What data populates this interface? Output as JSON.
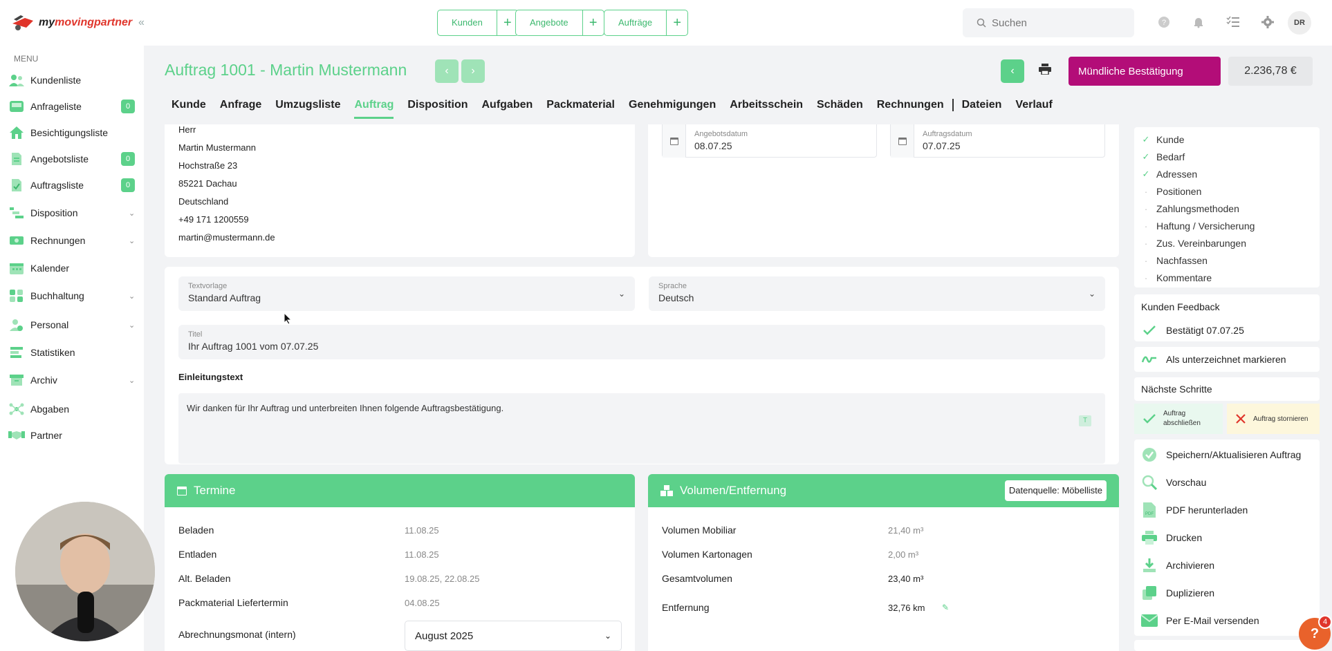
{
  "brand": {
    "name_prefix": "my",
    "name_rest": "movingpartner",
    "accent": "#e0352b",
    "green": "#5cd18a",
    "magenta": "#b30d78"
  },
  "topbar": {
    "quick_actions": [
      {
        "label": "Kunden",
        "plus": "+"
      },
      {
        "label": "Angebote",
        "plus": "+"
      },
      {
        "label": "Aufträge",
        "plus": "+"
      }
    ],
    "search": {
      "placeholder": "Suchen"
    },
    "icons": [
      "help-circle-icon",
      "bell-icon",
      "checklist-icon",
      "gear-icon"
    ],
    "avatar_initials": "DR"
  },
  "sidebar": {
    "caption": "MENU",
    "collapse_icon": "«",
    "items": [
      {
        "label": "Kundenliste",
        "icon": "users-icon"
      },
      {
        "label": "Anfrageliste",
        "icon": "inbox-icon",
        "badge": "0"
      },
      {
        "label": "Besichtigungsliste",
        "icon": "house-icon"
      },
      {
        "label": "Angebotsliste",
        "icon": "document-icon",
        "badge": "0"
      },
      {
        "label": "Auftragsliste",
        "icon": "order-document-icon",
        "badge": "0"
      },
      {
        "label": "Disposition",
        "icon": "dispatch-icon",
        "expandable": true
      },
      {
        "label": "Rechnungen",
        "icon": "invoice-icon",
        "expandable": true
      },
      {
        "label": "Kalender",
        "icon": "calendar-icon"
      },
      {
        "label": "Buchhaltung",
        "icon": "accounting-icon",
        "expandable": true
      },
      {
        "label": "Personal",
        "icon": "staff-icon",
        "expandable": true
      },
      {
        "label": "Statistiken",
        "icon": "statistics-icon"
      },
      {
        "label": "Archiv",
        "icon": "archive-icon",
        "expandable": true
      },
      {
        "label": "Abgaben",
        "icon": "network-icon"
      },
      {
        "label": "Partner",
        "icon": "handshake-icon"
      }
    ]
  },
  "header": {
    "title": "Auftrag 1001 - Martin Mustermann",
    "confirm_button": "Mündliche Bestätigung",
    "total": "2.236,78 €"
  },
  "tabs": [
    "Kunde",
    "Anfrage",
    "Umzugsliste",
    "Auftrag",
    "Disposition",
    "Aufgaben",
    "Packmaterial",
    "Genehmigungen",
    "Arbeitsschein",
    "Schäden",
    "Rechnungen",
    "Dateien",
    "Verlauf"
  ],
  "active_tab": "Auftrag",
  "customer": {
    "lines": [
      "Herr",
      "Martin Mustermann",
      "Hochstraße 23",
      "85221 Dachau",
      "Deutschland",
      "+49 171 1200559",
      "martin@mustermann.de"
    ]
  },
  "dates": {
    "offer": {
      "label": "Angebotsdatum",
      "value": "08.07.25"
    },
    "order": {
      "label": "Auftragsdatum",
      "value": "07.07.25"
    }
  },
  "text_form": {
    "template": {
      "label": "Textvorlage",
      "value": "Standard Auftrag"
    },
    "language": {
      "label": "Sprache",
      "value": "Deutsch"
    },
    "title": {
      "label": "Titel",
      "value": "Ihr Auftrag 1001 vom 07.07.25"
    },
    "intro": {
      "label": "Einleitungstext",
      "value": "Wir danken für Ihr Auftrag und unterbreiten Ihnen folgende Auftragsbestätigung.",
      "format_button": "T"
    }
  },
  "termine": {
    "heading": "Termine",
    "rows": [
      {
        "label": "Beladen",
        "value": "11.08.25"
      },
      {
        "label": "Entladen",
        "value": "11.08.25"
      },
      {
        "label": "Alt. Beladen",
        "value": "19.08.25, 22.08.25"
      },
      {
        "label": "Packmaterial Liefertermin",
        "value": "04.08.25"
      }
    ],
    "billing_month": {
      "label": "Abrechnungsmonat (intern)",
      "value": "August 2025"
    }
  },
  "volumen": {
    "heading": "Volumen/Entfernung",
    "source_button": "Datenquelle: Möbelliste",
    "rows": [
      {
        "label": "Volumen Mobiliar",
        "value": "21,40 m³"
      },
      {
        "label": "Volumen Kartonagen",
        "value": "2,00 m³"
      },
      {
        "label": "Gesamtvolumen",
        "value": "23,40 m³"
      }
    ],
    "distance": {
      "label": "Entfernung",
      "value": "32,76 km"
    }
  },
  "checklist": [
    {
      "label": "Kunde",
      "done": true
    },
    {
      "label": "Bedarf",
      "done": true
    },
    {
      "label": "Adressen",
      "done": true
    },
    {
      "label": "Positionen",
      "done": false
    },
    {
      "label": "Zahlungsmethoden",
      "done": false
    },
    {
      "label": "Haftung / Versicherung",
      "done": false
    },
    {
      "label": "Zus. Vereinbarungen",
      "done": false
    },
    {
      "label": "Nachfassen",
      "done": false
    },
    {
      "label": "Kommentare",
      "done": false
    }
  ],
  "feedback": {
    "heading": "Kunden Feedback",
    "status": "Bestätigt 07.07.25"
  },
  "mark_signed": "Als unterzeichnet markieren",
  "next_steps": {
    "heading": "Nächste Schritte",
    "complete": "Auftrag abschließen",
    "cancel": "Auftrag stornieren"
  },
  "actions": [
    {
      "label": "Speichern/Aktualisieren Auftrag",
      "icon": "save-check-icon"
    },
    {
      "label": "Vorschau",
      "icon": "magnifier-icon"
    },
    {
      "label": "PDF herunterladen",
      "icon": "pdf-icon"
    },
    {
      "label": "Drucken",
      "icon": "printer-icon"
    },
    {
      "label": "Archivieren",
      "icon": "download-archive-icon"
    },
    {
      "label": "Duplizieren",
      "icon": "duplicate-icon"
    },
    {
      "label": "Per E-Mail versenden",
      "icon": "mail-icon"
    }
  ],
  "help": {
    "label": "?",
    "badge": "4"
  }
}
